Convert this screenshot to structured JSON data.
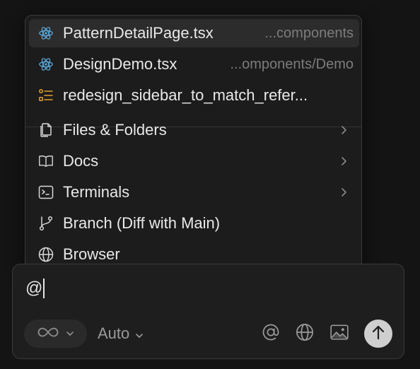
{
  "mention_menu": {
    "recent": [
      {
        "label": "PatternDetailPage.tsx",
        "path": "...components",
        "icon": "react-icon"
      },
      {
        "label": "DesignDemo.tsx",
        "path": "...omponents/Demo",
        "icon": "react-icon"
      },
      {
        "label": "redesign_sidebar_to_match_refer...",
        "icon": "list-icon"
      }
    ],
    "categories": [
      {
        "label": "Files & Folders",
        "icon": "files-icon",
        "has_submenu": true
      },
      {
        "label": "Docs",
        "icon": "book-icon",
        "has_submenu": true
      },
      {
        "label": "Terminals",
        "icon": "terminal-icon",
        "has_submenu": true
      },
      {
        "label": "Branch (Diff with Main)",
        "icon": "git-branch-icon",
        "has_submenu": false
      },
      {
        "label": "Browser",
        "icon": "globe-icon",
        "has_submenu": false
      }
    ]
  },
  "composer": {
    "input_value": "@",
    "mode_icon": "infinity-icon",
    "model_label": "Auto",
    "tools": [
      "at-icon",
      "globe-icon",
      "image-icon"
    ],
    "send_icon": "arrow-up-icon",
    "colors": {
      "accent_react": "#5aa7d8",
      "accent_list": "#e0a030",
      "send_bg": "#cfcfcf"
    }
  }
}
